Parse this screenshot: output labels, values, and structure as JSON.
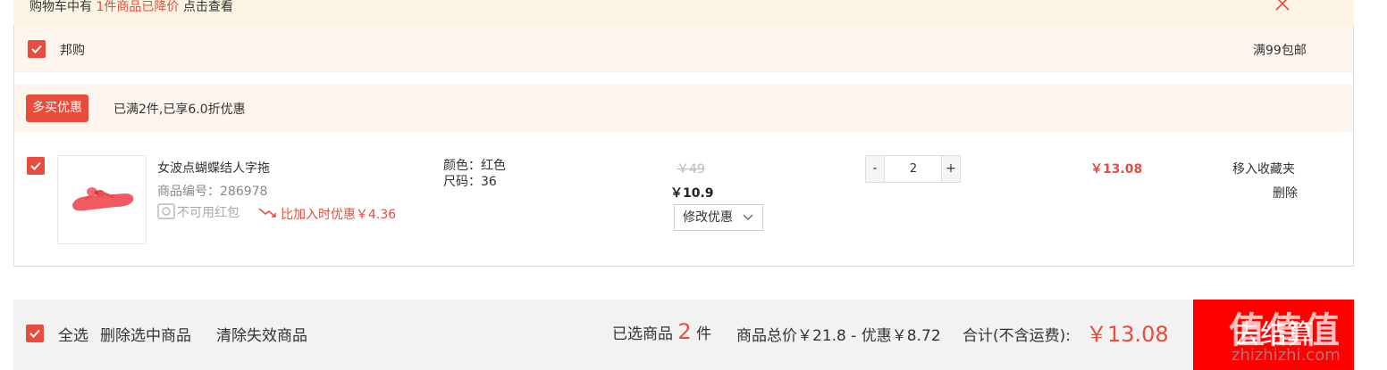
{
  "notice": {
    "prefix": "购物车中有",
    "highlight": "1件商品已降价",
    "suffix": "点击查看"
  },
  "shop": {
    "name": "邦购",
    "shipping": "满99包邮"
  },
  "promo": {
    "tag": "多买优惠",
    "text": "已满2件,已享6.0折优惠"
  },
  "item": {
    "title": "女波点蝴蝶结人字拖",
    "sku_label": "商品编号：286978",
    "coupon_text": "不可用红包",
    "drop_text": "比加入时优惠￥4.36",
    "attr_color": "颜色：红色",
    "attr_size": "尺码：36",
    "original_price": "￥49",
    "price": "￥10.9",
    "modify_label": "修改优惠",
    "quantity": "2",
    "subtotal": "￥13.08",
    "move_fav": "移入收藏夹",
    "delete": "删除"
  },
  "footer": {
    "select_all": "全选",
    "delete_selected": "删除选中商品",
    "clear_invalid": "清除失效商品",
    "selected_prefix": "已选商品",
    "selected_count": "2",
    "selected_suffix": "件",
    "summary": "商品总价￥21.8 - 优惠￥8.72",
    "total_label": "合计(不含运费):",
    "total": "￥13.08",
    "checkout": "去结算"
  },
  "watermark": {
    "text": "值值值",
    "url": "zhizhizhi.com"
  },
  "colors": {
    "accent": "#e84c3d",
    "checkout": "#ff0000",
    "notice_bg": "#fbf4e2",
    "row_bg": "#fdf5ee"
  }
}
